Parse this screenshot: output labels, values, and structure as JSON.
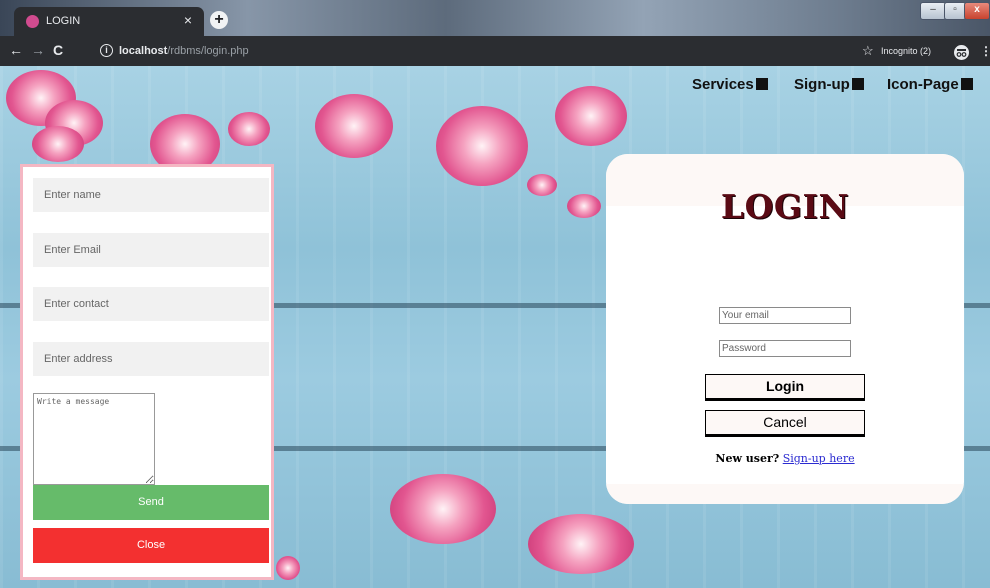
{
  "browser": {
    "tab_title": "LOGIN",
    "tab_close": "×",
    "new_tab": "+",
    "url_host": "localhost",
    "url_path": "/rdbms/login.php",
    "incognito_label": "Incognito (2)",
    "window_buttons": {
      "minimize": "–",
      "maximize": "▫",
      "close": "x"
    },
    "icons": {
      "back": "back-arrow-icon",
      "forward": "forward-arrow-icon",
      "reload": "reload-icon",
      "info": "info-icon",
      "star": "star-icon",
      "menu": "kebab-menu-icon"
    }
  },
  "nav": {
    "items": [
      {
        "label": "Services",
        "icon": "gift-icon"
      },
      {
        "label": "Sign-up",
        "icon": "contact-card-icon"
      },
      {
        "label": "Icon-Page",
        "icon": "edit-icon"
      }
    ]
  },
  "side_form": {
    "name_placeholder": "Enter name",
    "email_placeholder": "Enter Email",
    "contact_placeholder": "Enter contact",
    "address_placeholder": "Enter address",
    "message_placeholder": "Write a message",
    "send_label": "Send",
    "close_label": "Close",
    "colors": {
      "send": "#66bb6a",
      "close": "#f33030",
      "border": "#f4b7c3"
    }
  },
  "login": {
    "title": "LOGIN",
    "email_placeholder": "Your email",
    "password_placeholder": "Password",
    "login_label": "Login",
    "cancel_label": "Cancel",
    "new_user_label": "New user?",
    "signup_link": "Sign-up here",
    "colors": {
      "title": "#5a0a14",
      "link": "#2b2bd1"
    }
  }
}
